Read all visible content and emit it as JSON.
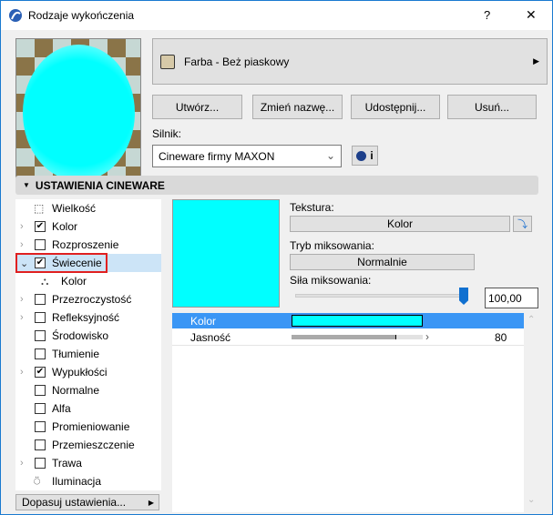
{
  "window": {
    "title": "Rodzaje wykończenia",
    "help": "?",
    "close": "✕"
  },
  "material": {
    "name": "Farba - Beż piaskowy",
    "swatch_color": "#d6c9a8"
  },
  "buttons": {
    "create": "Utwórz...",
    "rename": "Zmień nazwę...",
    "share": "Udostępnij...",
    "delete": "Usuń..."
  },
  "engine": {
    "label": "Silnik:",
    "value": "Cineware firmy MAXON",
    "info": "i"
  },
  "section": {
    "title": "USTAWIENIA CINEWARE"
  },
  "tree": [
    {
      "label": "Wielkość",
      "icon": "size-icon"
    },
    {
      "label": "Kolor",
      "checked": true,
      "chevron": true
    },
    {
      "label": "Rozproszenie",
      "checked": false,
      "chevron": true
    },
    {
      "label": "Świecenie",
      "checked": true,
      "chevron": true,
      "expanded": true,
      "selected": true
    },
    {
      "label": "Kolor",
      "icon": "color-channel-icon",
      "child": true
    },
    {
      "label": "Przezroczystość",
      "checked": false,
      "chevron": true
    },
    {
      "label": "Refleksyjność",
      "checked": false,
      "chevron": true
    },
    {
      "label": "Środowisko",
      "checked": false
    },
    {
      "label": "Tłumienie",
      "checked": false
    },
    {
      "label": "Wypukłości",
      "checked": true,
      "chevron": true
    },
    {
      "label": "Normalne",
      "checked": false
    },
    {
      "label": "Alfa",
      "checked": false
    },
    {
      "label": "Promieniowanie",
      "checked": false
    },
    {
      "label": "Przemieszczenie",
      "checked": false
    },
    {
      "label": "Trawa",
      "checked": false,
      "chevron": true
    },
    {
      "label": "Iluminacja",
      "icon": "illumination-icon"
    }
  ],
  "adjust": {
    "label": "Dopasuj ustawienia..."
  },
  "panel": {
    "preview_color": "#00ffff",
    "texture_label": "Tekstura:",
    "texture_value": "Kolor",
    "blend_label": "Tryb miksowania:",
    "blend_value": "Normalnie",
    "strength_label": "Siła miksowania:",
    "strength_value": "100,00",
    "strength_fraction": 1.0
  },
  "props": [
    {
      "name": "Kolor",
      "color": "#00ffff"
    },
    {
      "name": "Jasność",
      "value": "80",
      "fraction": 0.8
    }
  ]
}
